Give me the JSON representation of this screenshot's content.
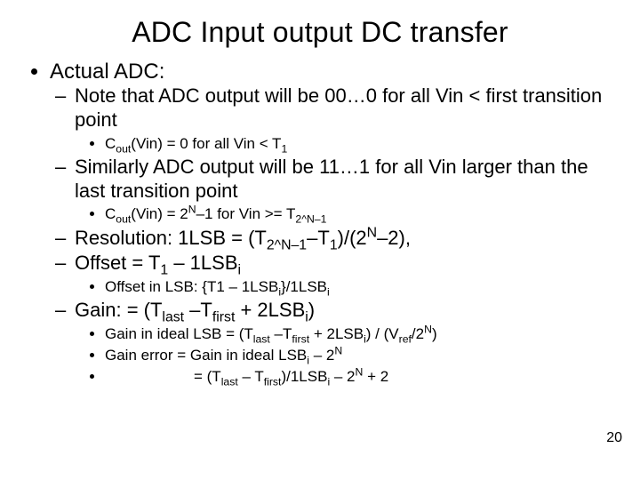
{
  "title": "ADC Input output DC transfer",
  "lvl1_item": "Actual ADC:",
  "l2_a": "Note that ADC output will be 00…0 for all Vin < first transition point",
  "l2_a_sub1_pre": "C",
  "l2_a_sub1_mid": "(Vin) = 0 for all Vin < T",
  "l2_b": "Similarly ADC output will be 11…1 for all Vin larger than the last transition point",
  "l2_b_sub1_pre": "C",
  "l2_b_sub1_mid": "(Vin) = 2",
  "l2_b_sub1_after": "–1 for Vin >= T",
  "l2_c_pre": "Resolution: 1LSB = (T",
  "l2_c_mid": "–T",
  "l2_c_after": ")/(2",
  "l2_c_end": "–2),",
  "l2_d_pre": "Offset = T",
  "l2_d_mid": " – 1LSB",
  "l2_d_sub_pre": "Offset in LSB: {T1 – 1LSB",
  "l2_d_sub_mid": "}/1LSB",
  "l2_e_pre": "Gain: = (T",
  "l2_e_mid": " –T",
  "l2_e_after": " + 2LSB",
  "l2_e_end": ")",
  "l2_e_sub1_pre": "Gain in ideal LSB = (T",
  "l2_e_sub1_a": " –T",
  "l2_e_sub1_b": " + 2LSB",
  "l2_e_sub1_c": ") / (V",
  "l2_e_sub1_d": "/2",
  "l2_e_sub1_e": ")",
  "l2_e_sub2_pre": "Gain error = Gain in ideal LSB",
  "l2_e_sub2_after": " – 2",
  "l2_e_sub3_pre": "= (T",
  "l2_e_sub3_a": " – T",
  "l2_e_sub3_b": ")/1LSB",
  "l2_e_sub3_c": " – 2",
  "l2_e_sub3_d": " + 2",
  "sub_out": "out",
  "sub_1": "1",
  "sub_i": "i",
  "sub_last": "last",
  "sub_first": "first",
  "sub_ref": "ref",
  "sub_2Nm1": "2^N–1",
  "sup_N": "N",
  "page_number": "20"
}
